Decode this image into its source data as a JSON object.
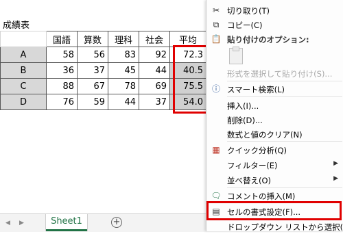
{
  "sheet": {
    "title": "成績表",
    "headers": [
      "国語",
      "算数",
      "理科",
      "社会",
      "平均"
    ],
    "rows": [
      {
        "name": "A",
        "values": [
          "58",
          "56",
          "83",
          "92",
          "72.3"
        ]
      },
      {
        "name": "B",
        "values": [
          "36",
          "37",
          "45",
          "44",
          "40.5"
        ]
      },
      {
        "name": "C",
        "values": [
          "88",
          "67",
          "78",
          "69",
          "75.5"
        ]
      },
      {
        "name": "D",
        "values": [
          "76",
          "59",
          "44",
          "37",
          "54.0"
        ]
      }
    ],
    "tab_name": "Sheet1",
    "add_sheet": "+",
    "highlight_color": "#e00000"
  },
  "context_menu": {
    "cut": "切り取り(T)",
    "copy": "コピー(C)",
    "paste_options": "貼り付けのオプション:",
    "paste_special": "形式を選択して貼り付け(S)...",
    "smart_lookup": "スマート検索(L)",
    "insert": "挿入(I)...",
    "delete": "削除(D)...",
    "clear_contents": "数式と値のクリア(N)",
    "quick_analysis": "クイック分析(Q)",
    "filter": "フィルター(E)",
    "sort": "並べ替え(O)",
    "insert_comment": "コメントの挿入(M)",
    "format_cells": "セルの書式設定(F)...",
    "dropdown_list": "ドロップダウン リストから選択(K)..."
  }
}
